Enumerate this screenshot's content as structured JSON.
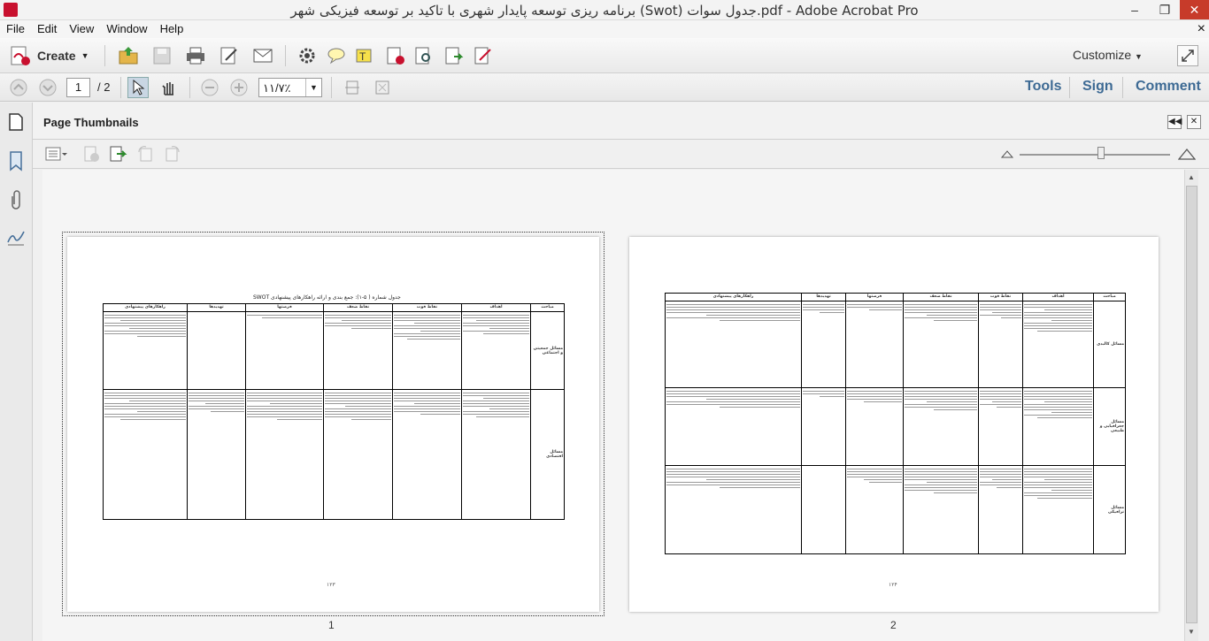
{
  "window": {
    "title": "برنامه ریزی توسعه پایدار شهری با تاکید بر توسعه فیزیکی شهر (Swot) جدول سوات.pdf - Adobe Acrobat Pro",
    "minimize": "–",
    "restore": "❐",
    "close": "✕"
  },
  "menu": [
    "File",
    "Edit",
    "View",
    "Window",
    "Help"
  ],
  "menu_close": "×",
  "toolbar": {
    "create_label": "Create",
    "customize_label": "Customize"
  },
  "nav": {
    "current_page": "1",
    "total_pages": "/ 2",
    "zoom": "۱۱/۷٪"
  },
  "right_tabs": [
    "Tools",
    "Sign",
    "Comment"
  ],
  "panel": {
    "title": "Page Thumbnails"
  },
  "pages": [
    {
      "label": "1",
      "footer": "۱۲۳",
      "caption": "جدول شماره ( ۵-۱): جمع بندی و ارائه راهکارهای پیشنهادی SWOT",
      "headers": [
        "مباحث",
        "اهداف",
        "نقاط قوت",
        "نقاط ضعف",
        "فرصتها",
        "تهدیدها",
        "راهکارهای پیشنهادی"
      ],
      "rows": [
        "مسائل جمعیتی و اجتماعی",
        "مسائل اقتصادی"
      ]
    },
    {
      "label": "2",
      "footer": "۱۲۴",
      "headers": [
        "مباحث",
        "اهداف",
        "نقاط قوت",
        "نقاط ضعف",
        "فرصتها",
        "تهدیدها",
        "راهکارهای پیشنهادی"
      ],
      "rows": [
        "مسائل کالبدی",
        "مسائل جغرافیایی و طبیعی",
        "مسائل ترافیکی"
      ]
    }
  ],
  "colors": {
    "accent": "#3d6a94",
    "pdf_red": "#c8102e"
  }
}
